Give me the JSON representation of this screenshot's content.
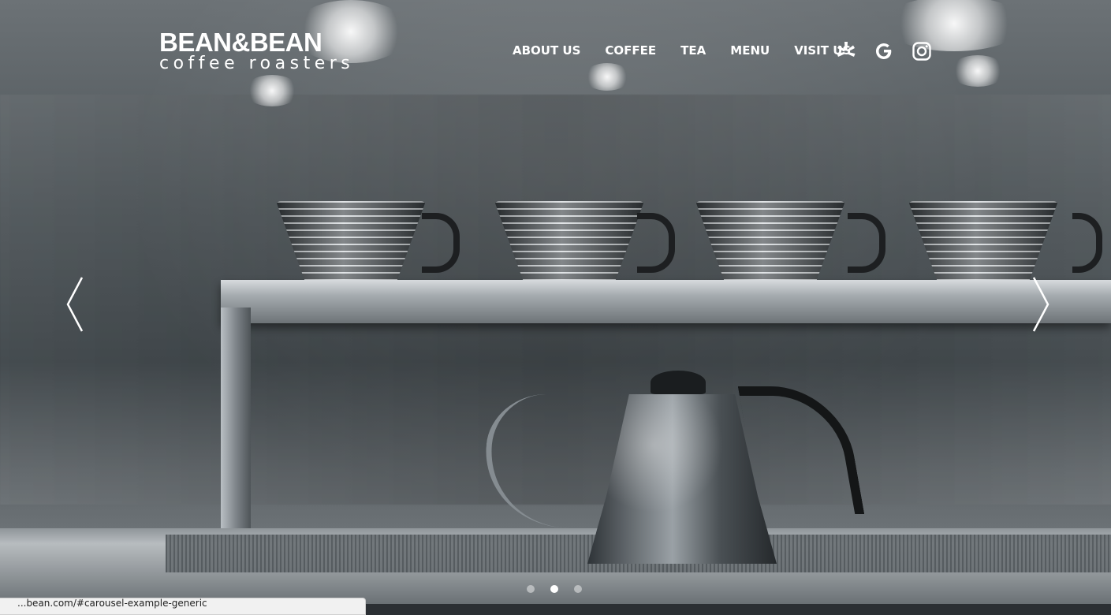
{
  "brand": {
    "name": "BEAN&BEAN",
    "tagline": "coffee roasters"
  },
  "nav": {
    "items": [
      {
        "label": "ABOUT US"
      },
      {
        "label": "COFFEE"
      },
      {
        "label": "TEA"
      },
      {
        "label": "MENU"
      },
      {
        "label": "VISIT US"
      }
    ]
  },
  "social": {
    "icons": [
      "yelp-icon",
      "google-icon",
      "instagram-icon"
    ]
  },
  "carousel": {
    "slide_count": 3,
    "active_slide": 2
  },
  "status_bar": {
    "text": "...bean.com/#carousel-example-generic"
  },
  "colors": {
    "nav_text": "#ffffff",
    "dot_active": "#ffffff",
    "dot_inactive": "rgba(255,255,255,0.45)"
  }
}
